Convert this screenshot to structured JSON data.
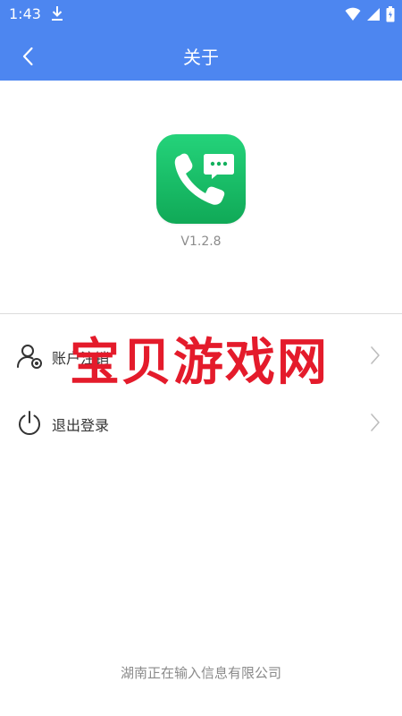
{
  "status_bar": {
    "time": "1:43"
  },
  "header": {
    "title": "关于"
  },
  "about": {
    "version": "V1.2.8"
  },
  "list": {
    "items": [
      {
        "label": "账户注销"
      },
      {
        "label": "退出登录"
      }
    ]
  },
  "watermark": {
    "text": "宝贝游戏网"
  },
  "footer": {
    "company": "湖南正在输入信息有限公司"
  },
  "colors": {
    "accent": "#4d86f0",
    "app_icon_green": "#10a957",
    "watermark_red": "#e41b2b"
  },
  "icons": {
    "back": "chevron-left-icon",
    "download": "download-icon",
    "wifi": "wifi-icon",
    "signal": "signal-icon",
    "battery": "battery-icon",
    "account": "user-remove-icon",
    "logout": "power-icon",
    "chevron": "chevron-right-icon"
  }
}
